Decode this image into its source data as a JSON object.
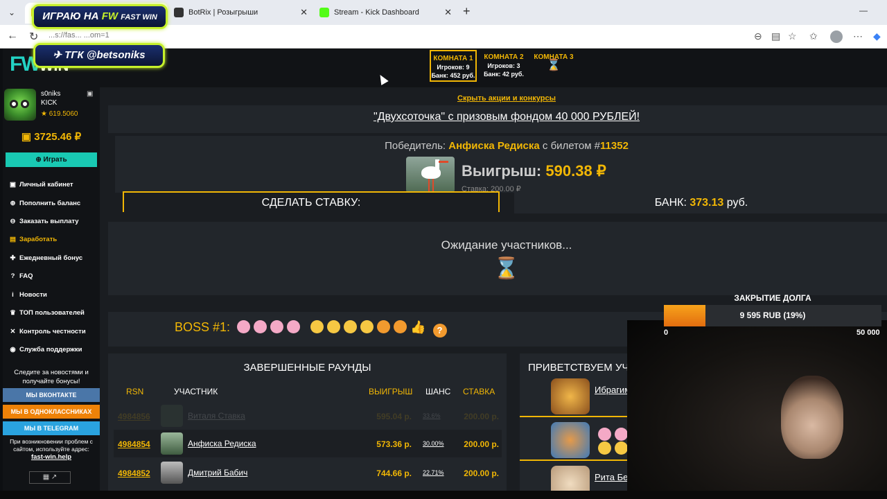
{
  "browser": {
    "tabs": [
      {
        "title": "",
        "favicon_color": "#f2b705"
      },
      {
        "title": "BotRix | Розыгрыши",
        "favicon_color": "#333333"
      },
      {
        "title": "Stream - Kick Dashboard",
        "favicon_color": "#53fc18"
      }
    ],
    "url": "...s://fas... ...om=1"
  },
  "overlays": {
    "badge1": {
      "prefix": "ИГРАЮ НА",
      "brand": "FW",
      "suffix": "FAST WIN"
    },
    "badge2": {
      "text": "ТГК @betsoniks"
    },
    "debt": {
      "title": "ЗАКРЫТИЕ ДОЛГА",
      "value": "9 595 RUB (19%)",
      "progress": 0.19,
      "min": "0",
      "max": "50 000"
    }
  },
  "site": {
    "logo_fw": "FW",
    "logo_win": "WIN",
    "rooms": [
      {
        "title": "КОМНАТА 1",
        "players": "Игроков: 9",
        "bank": "Банк: 452 руб.",
        "active": true
      },
      {
        "title": "КОМНАТА 2",
        "players": "Игроков: 3",
        "bank": "Банк: 42 руб.",
        "active": false
      },
      {
        "title": "КОМНАТА 3",
        "players": "",
        "bank": "",
        "active": false
      }
    ],
    "user": {
      "name": "s0niks",
      "platform": "KICK",
      "rating": "★ 619.5060",
      "balance": "3725.46 ₽"
    },
    "play_button": "⊕ Играть",
    "menu": [
      {
        "label": "Личный кабинет",
        "icon": "briefcase-icon",
        "glyph": "▣"
      },
      {
        "label": "Пополнить баланс",
        "icon": "plus-circle-icon",
        "glyph": "⊕"
      },
      {
        "label": "Заказать выплату",
        "icon": "minus-circle-icon",
        "glyph": "⊖"
      },
      {
        "label": "Заработать",
        "icon": "money-icon",
        "glyph": "▤"
      },
      {
        "label": "Ежедневный бонус",
        "icon": "gift-icon",
        "glyph": "✚"
      },
      {
        "label": "FAQ",
        "icon": "question-icon",
        "glyph": "?"
      },
      {
        "label": "Новости",
        "icon": "info-icon",
        "glyph": "i"
      },
      {
        "label": "ТОП пользователей",
        "icon": "trophy-icon",
        "glyph": "♛"
      },
      {
        "label": "Контроль честности",
        "icon": "shuffle-icon",
        "glyph": "✕"
      },
      {
        "label": "Служба поддержки",
        "icon": "support-icon",
        "glyph": "◉"
      }
    ],
    "side_note": "Следите за новостями и получайте бонусы!",
    "socials": [
      {
        "label": "МЫ ВКОНТАКТЕ",
        "color": "#4a76a8"
      },
      {
        "label": "МЫ В ОДНОКЛАССНИКАХ",
        "color": "#ee8208"
      },
      {
        "label": "МЫ В TELEGRAM",
        "color": "#2aa3df"
      }
    ],
    "footer_note": "При возникновении проблем с сайтом, используйте адрес:",
    "footer_link": "fast-win.help"
  },
  "main": {
    "hide_link": "Скрыть акции и конкурсы",
    "promo": "\"Двухсоточка\" с призовым фондом 40 000 РУБЛЕЙ!",
    "winner": {
      "prefix": "Победитель:",
      "name": "Анфиска Редиска",
      "mid": "с билетом #",
      "ticket": "11352",
      "win_label": "Выигрыш:",
      "win_value": "590.38 ₽",
      "stake": "Ставка: 200.00 ₽"
    },
    "bet_label": "СДЕЛАТЬ СТАВКУ:",
    "bank": {
      "label": "БАНК:",
      "value": "373.13",
      "unit": "руб."
    },
    "waiting": "Ожидание участников...",
    "boss": "BOSS #1:",
    "rounds": {
      "title": "ЗАВЕРШЕННЫЕ РАУНДЫ",
      "headers": {
        "rsn": "RSN",
        "player": "УЧАСТНИК",
        "win": "ВЫИГРЫШ",
        "chance": "ШАНС",
        "stake": "СТАВКА"
      },
      "rows": [
        {
          "id": "4984856",
          "name": "Виталя Ставка",
          "win": "595.04 р.",
          "chance": "33.6%",
          "stake": "200.00 р.",
          "faded": true
        },
        {
          "id": "4984854",
          "name": "Анфиска Редиска",
          "win": "573.36 р.",
          "chance": "30.00%",
          "stake": "200.00 р.",
          "faded": false
        },
        {
          "id": "4984852",
          "name": "Дмитрий Бабич",
          "win": "744.66 р.",
          "chance": "22.71%",
          "stake": "200.00 р.",
          "faded": false
        }
      ]
    },
    "welcome": {
      "title": "ПРИВЕТСТВУЕМ УЧАСТНИКОВ",
      "items": [
        {
          "name": "Ибрагим Пироно...",
          "color": "#e5a33c"
        },
        {
          "name": "",
          "color": "#6aa3d8"
        },
        {
          "name": "Рита Белова...",
          "color": "#e8d1b5"
        }
      ]
    }
  }
}
